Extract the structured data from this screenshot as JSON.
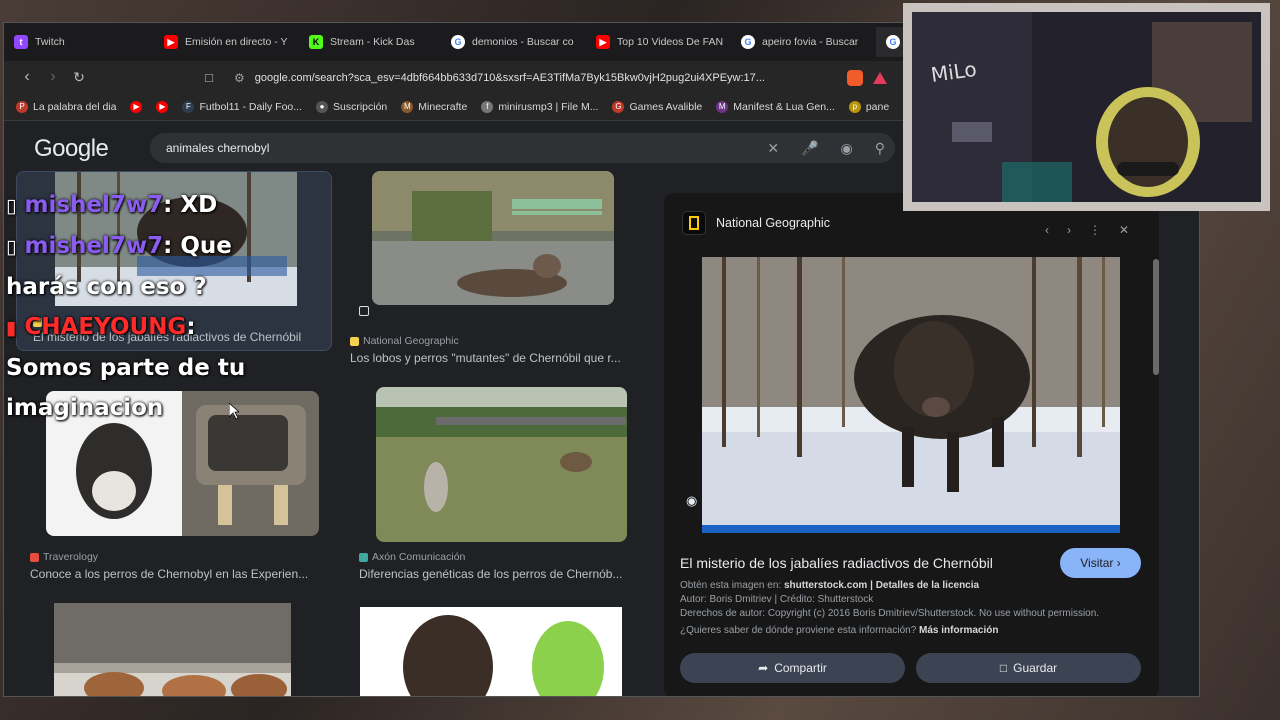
{
  "browser": {
    "tabs": [
      {
        "label": "Twitch",
        "icon": "twitch-icon",
        "color": "#9146ff"
      },
      {
        "label": "Emisión en directo - Y",
        "icon": "youtube-icon",
        "color": "#ff0000"
      },
      {
        "label": "Stream - Kick Das",
        "icon": "kick-icon",
        "color": "#53fc18"
      },
      {
        "label": "demonios - Buscar co",
        "icon": "google-icon",
        "color": "#4285f4"
      },
      {
        "label": "Top 10 Videos De FAN",
        "icon": "youtube-icon",
        "color": "#ff0000"
      },
      {
        "label": "apeiro fovia - Buscar",
        "icon": "google-icon",
        "color": "#4285f4"
      }
    ],
    "url": "google.com/search?sca_esv=4dbf664bb633d710&sxsrf=AE3TifMa7Byk15Bkw0vjH2pug2ui4XPEyw:17...",
    "bookmarks": [
      {
        "label": "La palabra del dia",
        "color": "#c0392b"
      },
      {
        "label": "",
        "color": "#ff0000"
      },
      {
        "label": "",
        "color": "#ff0000"
      },
      {
        "label": "Futbol11 - Daily Foo...",
        "color": "#2c3e50"
      },
      {
        "label": "Suscripción",
        "color": "#555555"
      },
      {
        "label": "Minecrafte",
        "color": "#8b5a2b"
      },
      {
        "label": "minirusmp3 | File M...",
        "color": "#777777"
      },
      {
        "label": "Games Avalible",
        "color": "#c0392b"
      },
      {
        "label": "Manifest & Lua Gen...",
        "color": "#6c3483"
      },
      {
        "label": "pane",
        "color": "#b7950b"
      }
    ]
  },
  "google": {
    "logo": "Google",
    "query": "animales chernobyl"
  },
  "results": [
    {
      "source": "National Geographic",
      "caption": "Los lobos y perros \"mutantes\" de Chernóbil que r...",
      "color": "#f5d04d"
    },
    {
      "source": "Traverology",
      "caption": "Conoce a los perros de Chernobyl en las Experien...",
      "color": "#e74c3c"
    },
    {
      "source": "Axón Comunicación",
      "caption": "Diferencias genéticas de los perros de Chernób...",
      "color": "#3fa9a1"
    },
    {
      "source": "",
      "caption": "El misterio de los jabalíes radiactivos de Chernóbil",
      "color": "#f5d04d"
    }
  ],
  "panel": {
    "source": "National Geographic",
    "title": "El misterio de los jabalíes radiactivos de Chernóbil",
    "visit": "Visitar",
    "meta1_prefix": "Obtén esta imagen en: ",
    "meta1_link": "shutterstock.com",
    "meta1_sep": " | ",
    "meta1_link2": "Detalles de la licencia",
    "meta2": "Autor: Boris Dmitriev | Crédito: Shutterstock",
    "meta3": "Derechos de autor: Copyright (c) 2016 Boris Dmitriev/Shutterstock. No use without permission.",
    "meta4_prefix": "¿Quieres saber de dónde proviene esta información? ",
    "meta4_link": "Más información",
    "share": "Compartir",
    "save": "Guardar"
  },
  "chat": {
    "lines": [
      {
        "user": "mishel7w7",
        "text": ": XD"
      },
      {
        "user": "mishel7w7",
        "text": ": Que"
      },
      {
        "user": "",
        "text": "harás con eso ?"
      },
      {
        "user": "CHAEYOUNG",
        "text": ":"
      },
      {
        "user": "",
        "text": "Somos parte de tu"
      },
      {
        "user": "",
        "text": "imaginacion"
      }
    ]
  },
  "webcam": {
    "wall_text": "MiLo"
  }
}
